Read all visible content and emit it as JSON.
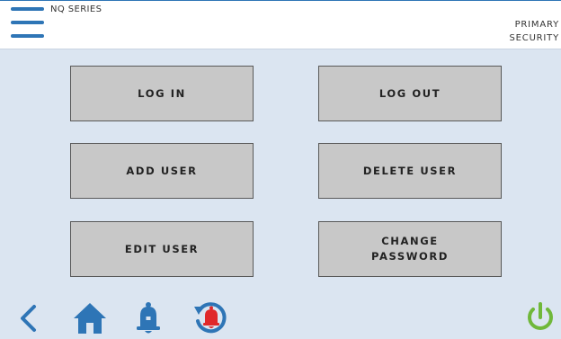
{
  "header": {
    "series_title": "NQ SERIES",
    "security_line1": "PRIMARY",
    "security_line2": "SECURITY"
  },
  "buttons": {
    "log_in": "LOG IN",
    "log_out": "LOG OUT",
    "add_user": "ADD USER",
    "delete_user": "DELETE USER",
    "edit_user": "EDIT USER",
    "change_password": "CHANGE\nPASSWORD"
  },
  "footer": {
    "icons": [
      "back-arrow-icon",
      "home-icon",
      "bell-icon",
      "alarm-history-icon",
      "power-icon"
    ]
  },
  "colors": {
    "accent": "#2e75b6",
    "background": "#dbe5f1",
    "button": "#c8c8c8",
    "alarm": "#e0282a",
    "power": "#70b83a"
  }
}
